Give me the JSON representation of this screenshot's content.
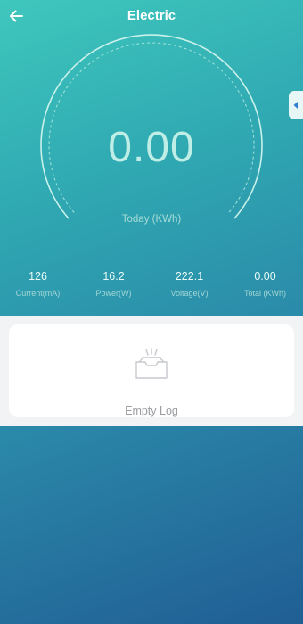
{
  "header": {
    "title": "Electric"
  },
  "gauge": {
    "today_value": "0.00",
    "today_label": "Today (KWh)"
  },
  "stats": [
    {
      "value": "126",
      "label": "Current(mA)"
    },
    {
      "value": "16.2",
      "label": "Power(W)"
    },
    {
      "value": "222.1",
      "label": "Voltage(V)"
    },
    {
      "value": "0.00",
      "label": "Total (KWh)"
    }
  ],
  "log": {
    "empty_text": "Empty Log"
  },
  "icons": {
    "back": "arrow-left-icon",
    "side_tab": "caret-left-icon",
    "empty": "empty-inbox-icon"
  },
  "colors": {
    "accent": "#3fc7bd",
    "gauge_text": "#bfeee6"
  }
}
